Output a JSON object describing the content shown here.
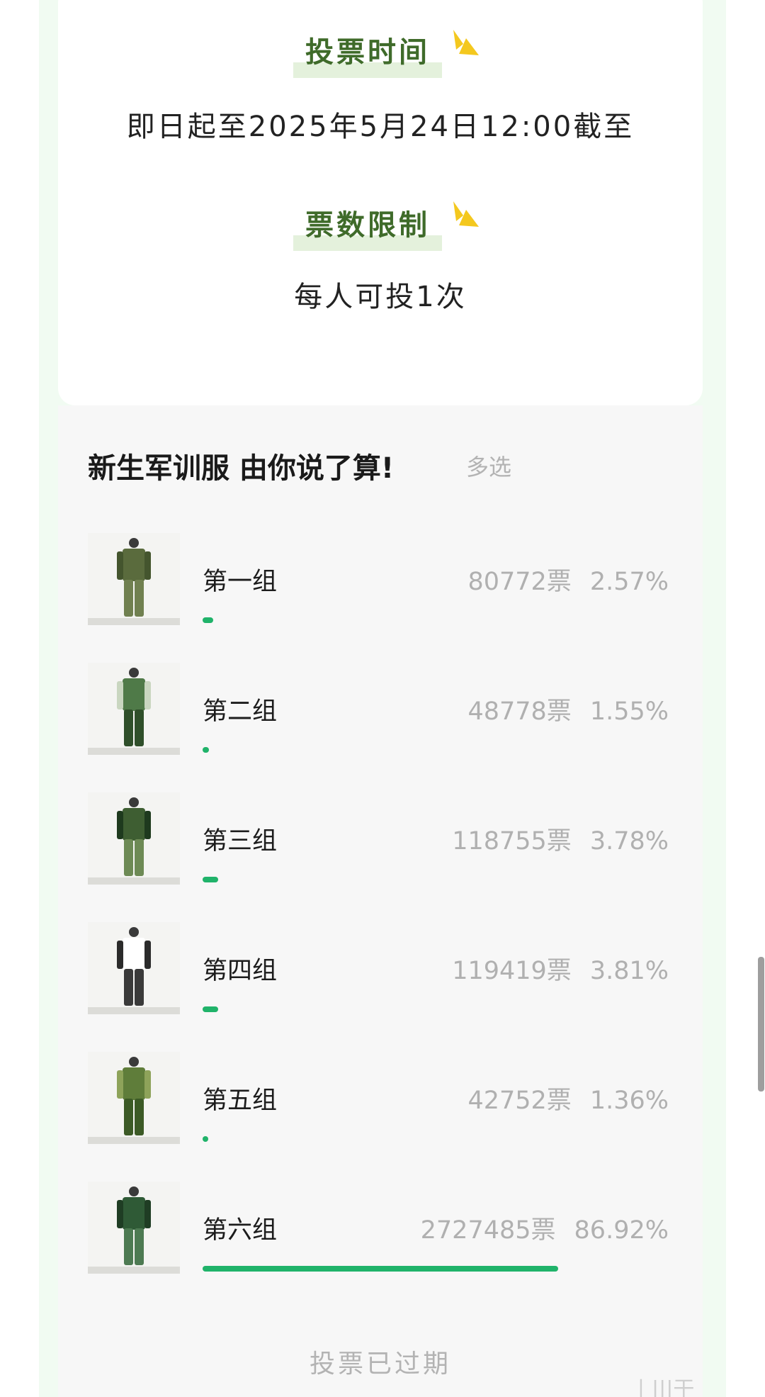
{
  "info": {
    "vote_time_heading": "投票时间",
    "vote_time_text": "即日起至2025年5月24日12:00截至",
    "vote_limit_heading": "票数限制",
    "vote_limit_text": "每人可投1次"
  },
  "vote": {
    "title": "新生军训服 由你说了算!",
    "mode": "多选",
    "expired_label": "投票已过期",
    "options": [
      {
        "name": "第一组",
        "votes": "80772票",
        "percent": "2.57%",
        "share": 2.57,
        "thumb_icon": "uniform-photo-icon",
        "colors": [
          "#5a6b3d",
          "#44552e",
          "#708050"
        ]
      },
      {
        "name": "第二组",
        "votes": "48778票",
        "percent": "1.55%",
        "share": 1.55,
        "thumb_icon": "uniform-photo-icon",
        "colors": [
          "#4f7a48",
          "#c9d6c0",
          "#2f4f2a"
        ]
      },
      {
        "name": "第三组",
        "votes": "118755票",
        "percent": "3.78%",
        "share": 3.78,
        "thumb_icon": "uniform-photo-icon",
        "colors": [
          "#3e5e32",
          "#1e3a1e",
          "#6d8a55"
        ]
      },
      {
        "name": "第四组",
        "votes": "119419票",
        "percent": "3.81%",
        "share": 3.81,
        "thumb_icon": "uniform-photo-icon",
        "colors": [
          "#ffffff",
          "#2b2b2b",
          "#3a3a3a"
        ]
      },
      {
        "name": "第五组",
        "votes": "42752票",
        "percent": "1.36%",
        "share": 1.36,
        "thumb_icon": "uniform-photo-icon",
        "colors": [
          "#5f7d3a",
          "#8ea35a",
          "#3c5a26"
        ]
      },
      {
        "name": "第六组",
        "votes": "2727485票",
        "percent": "86.92%",
        "share": 86.92,
        "thumb_icon": "uniform-photo-icon",
        "colors": [
          "#2f5a36",
          "#1f3d24",
          "#4d7a52"
        ]
      }
    ]
  },
  "colors": {
    "accent_green": "#20b36a",
    "heading_green": "#3f6b2a",
    "spark_yellow": "#f4c81e"
  }
}
